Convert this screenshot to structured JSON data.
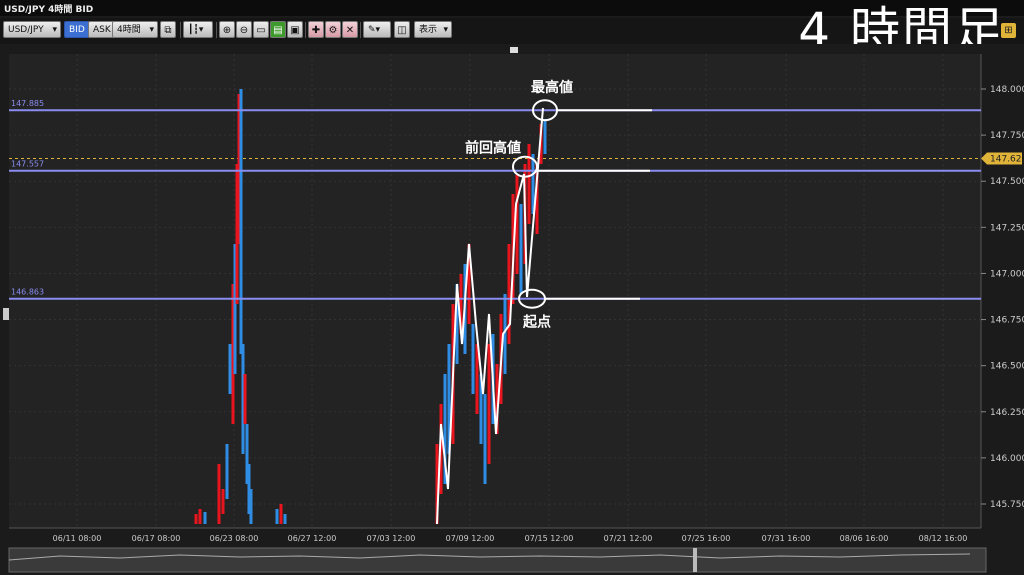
{
  "window": {
    "title": "USD/JPY 4時間 BID"
  },
  "overlay_title": "4 時間足",
  "toolbar": {
    "symbol": "USD/JPY",
    "bid_label": "BID",
    "ask_label": "ASK",
    "timeframe": "4時間",
    "display_label": "表示"
  },
  "price_axis": [
    "148.000",
    "147.750",
    "147.500",
    "147.250",
    "147.000",
    "146.750",
    "146.500",
    "146.250",
    "146.000",
    "145.750"
  ],
  "current_price": "147.623",
  "hlines": [
    {
      "label": "147.885",
      "value": 147.885,
      "color": "#8a8cf0"
    },
    {
      "label": "147.557",
      "value": 147.557,
      "color": "#8a8cf0"
    },
    {
      "label": "146.863",
      "value": 146.863,
      "color": "#8a8cf0"
    }
  ],
  "time_axis": [
    "06/11 08:00",
    "06/17 08:00",
    "06/23 08:00",
    "06/27 12:00",
    "07/03 12:00",
    "07/09 12:00",
    "07/15 12:00",
    "07/21 12:00",
    "07/25 16:00",
    "07/31 16:00",
    "08/06 16:00",
    "08/12 16:00"
  ],
  "annotations": {
    "high": "最高値",
    "prev_high": "前回高値",
    "start": "起点"
  },
  "colors": {
    "up": "#e8141e",
    "down": "#2f8de4",
    "hline": "#8a8cf0",
    "current": "#e0b339"
  }
}
